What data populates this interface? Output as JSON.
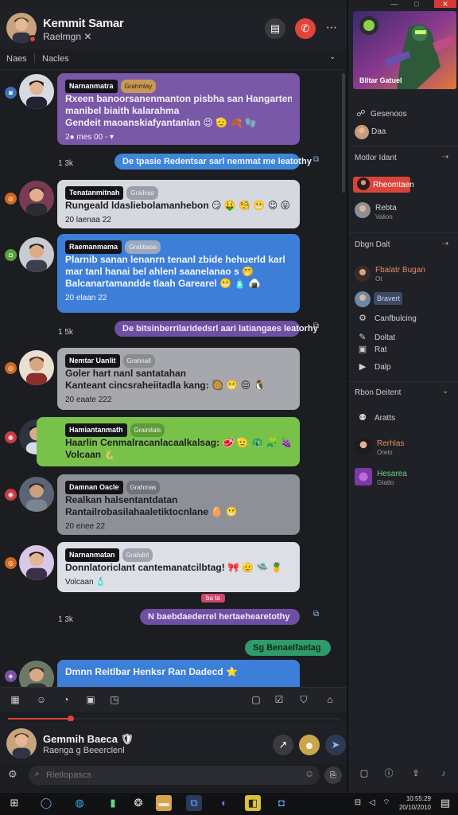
{
  "window": {
    "controls": [
      "—",
      "□",
      "✕"
    ]
  },
  "header": {
    "name": "Kemmit Samar",
    "subtitle": "Raelmgn ✕"
  },
  "tabs": {
    "first": "Naes",
    "second": "Nacles"
  },
  "messages": [
    {
      "name": "Narnanmatra",
      "role": "Grahmlay",
      "lines": [
        "Rxeen banoorsanenmanton pisbha san Hangarteni ls",
        "manibel biaith kalarahma",
        "Gendeit maoanskiafyantanlan 😉 🫡 🍂 🧤"
      ],
      "meta": "2● mes 00 - ▾"
    },
    {
      "pill": "De tpasie Redentsar sarl nemmat me leatothy",
      "count": "1 3k"
    },
    {
      "name": "Tenatanmitnah",
      "role": "Grailvas",
      "lines": [
        "Rungeald ldasliebolamanhebon 😏 🤑 🧐 😬 😉 😛"
      ],
      "meta": "20 laenaa 22"
    },
    {
      "name": "Raemanmama",
      "role": "Grahbase",
      "lines": [
        "Plarnib sanan lenanrn tenanl zbide hehuerld karl",
        "mar tanl hanai bel ahlenl saanelanao s 🤭",
        "Balcanartamandde tlaah Garearel 😬 🧴 🍙"
      ],
      "meta": "20 elaan 22"
    },
    {
      "pill": "De bitsinberrilaridedsrl aari latiangaes leatorhy",
      "count": "1 5k"
    },
    {
      "name": "Nemtar Uanlit",
      "role": "Grahnall",
      "lines": [
        "Goler hart nanl santatahan",
        "Kanteant cincsraheiitadla kang: 🥘 😬 😒 🐧"
      ],
      "meta": "20 eaate 222"
    },
    {
      "name": "Hamiantanmath",
      "role": "Grainitals",
      "lines": [
        "Haarlin Cenmalracanlacaalkalsag: 🥩 🫡 🦚 🧩 🍇",
        "Volcaan 🐍"
      ],
      "meta": ""
    },
    {
      "name": "Damnan Oacle",
      "role": "Grahmas",
      "lines": [
        "Realkan halsentantdatan",
        "Rantailrobasilahaaletiktocnlane 🥚 😬"
      ],
      "meta": "20 enee 22"
    },
    {
      "name": "Narnanmatan",
      "role": "Grahdnl",
      "lines": [
        "Donnlatoriclant cantemanatcilbtag! 🎀 🫡 🛸 🍍"
      ],
      "meta": "Volcaan 🧴"
    },
    {
      "pill": "N baebdaederrel hertaehearetothy",
      "count": "1 3k",
      "tag": "ba ta"
    },
    {
      "pill": "Sg Benaelfaetag",
      "count": ""
    },
    {
      "name": "",
      "role": "",
      "lines": [
        "Dmnn Reitlbar Henksr Ran Dadecd ⭐"
      ],
      "meta": ""
    }
  ],
  "toolbar": {
    "icons": [
      "grid-icon",
      "smile-icon",
      "gif-icon",
      "image-icon",
      "sticker-icon",
      "calendar-icon",
      "check-icon",
      "shield-icon",
      "home-icon"
    ],
    "progress": 0.19
  },
  "composer": {
    "name": "Gemmih Baeca 🛡",
    "subtitle": "Raenga g Beeerclenl"
  },
  "input": {
    "placeholder": "Rietlopascs"
  },
  "right_panel": {
    "game_caption": "Blitar Gatuel",
    "top_items": [
      "Gesenoos",
      "Daa"
    ],
    "sections": [
      {
        "title": "Motlor Idant",
        "items": [
          {
            "label": "Rheomtaen",
            "accent": true
          },
          {
            "label": "Rebta",
            "sub": "Valion"
          }
        ]
      },
      {
        "title": "Dbgn Dalt",
        "items": [
          {
            "label": "Fbalatr Bugan",
            "sub": "Ot"
          },
          {
            "label": "Bravert"
          },
          {
            "label": "Canfbulcing"
          },
          {
            "label": "Doltat"
          },
          {
            "label": "Rat"
          },
          {
            "label": "Dalp"
          }
        ]
      },
      {
        "title": "Rbon Deitent",
        "items": [
          {
            "label": "Aratts"
          },
          {
            "label": "Rerhlas",
            "sub": "Orelo"
          },
          {
            "label": "Hesarea",
            "sub": "Gtatlo"
          }
        ]
      }
    ],
    "bottom_icons": [
      "calendar-icon",
      "info-icon",
      "share-icon",
      "mic-icon"
    ]
  },
  "taskbar": {
    "time": "10:55:29",
    "date": "20/10/2010"
  },
  "colors": {
    "accent_red": "#e0443a",
    "bubble_blue": "#3d7ed8",
    "bubble_purple": "#7a58a8",
    "bubble_green": "#79c24a"
  }
}
